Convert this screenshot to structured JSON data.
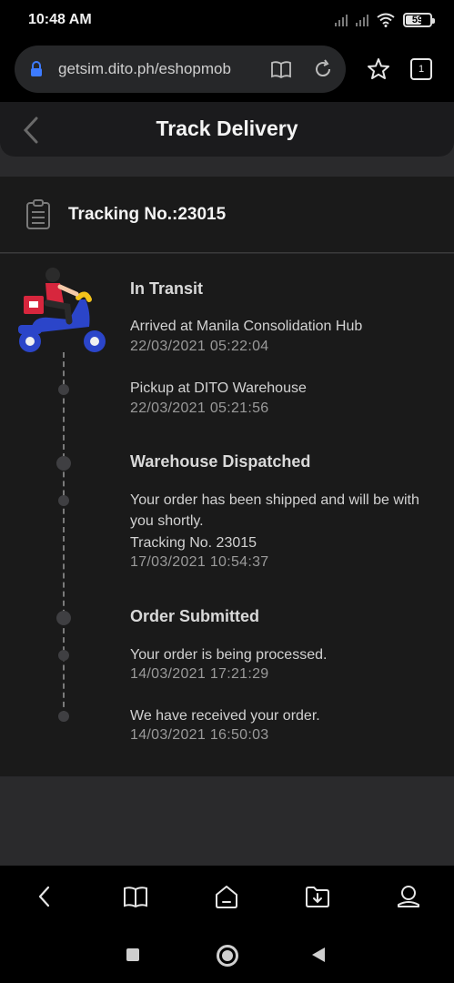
{
  "status_bar": {
    "time": "10:48 AM",
    "battery": "59",
    "battery_level": 0.59,
    "icons": [
      "signal-icon",
      "signal-icon",
      "wifi-icon",
      "battery-icon"
    ]
  },
  "browser": {
    "url": "getsim.dito.ph/eshopmob",
    "tab_count": "1",
    "icons": [
      "lock-icon",
      "reader-mode-icon",
      "reload-icon",
      "star-icon",
      "tabs-icon"
    ]
  },
  "header": {
    "title": "Track Delivery"
  },
  "tracking": {
    "label": "Tracking No.:23015"
  },
  "timeline": {
    "stages": [
      {
        "title": "In Transit",
        "events": [
          {
            "text": "Arrived at Manila Consolidation Hub",
            "time": "22/03/2021 05:22:04"
          },
          {
            "text": "Pickup at DITO Warehouse",
            "time": "22/03/2021 05:21:56"
          }
        ]
      },
      {
        "title": "Warehouse Dispatched",
        "events": [
          {
            "text": "Your order has been shipped and will be with you shortly.",
            "text2": "Tracking No. 23015",
            "time": "17/03/2021 10:54:37"
          }
        ]
      },
      {
        "title": "Order Submitted",
        "events": [
          {
            "text": "Your order is being processed.",
            "time": "14/03/2021 17:21:29"
          },
          {
            "text": "We have received your order.",
            "time": "14/03/2021 16:50:03"
          }
        ]
      }
    ]
  },
  "bottom_nav": [
    "back-icon",
    "bookmarks-icon",
    "home-icon",
    "downloads-icon",
    "profile-icon"
  ],
  "system_nav": [
    "recents-button",
    "home-button",
    "back-button"
  ]
}
